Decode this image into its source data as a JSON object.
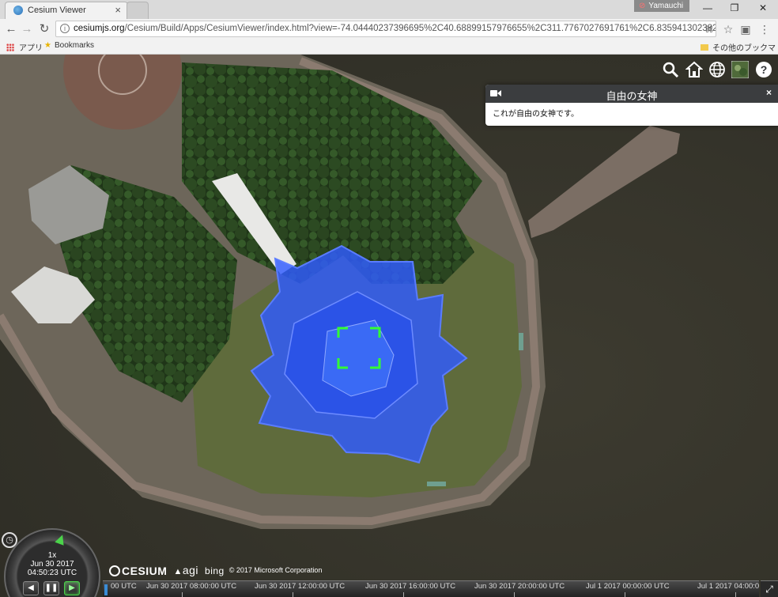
{
  "browser": {
    "tab_title": "Cesium Viewer",
    "tab_close": "×",
    "user_name": "Yamauchi",
    "window_min": "—",
    "window_restore": "❐",
    "window_close": "✕",
    "url_host": "cesiumjs.org",
    "url_rest": "/Cesium/Build/Apps/CesiumViewer/index.html?view=-74.04440237396695%2C40.68899157976655%2C311.7767027691761%2C6.835941302382751%2C-8",
    "bookmarks": {
      "apps": "アプリ",
      "bookmarks": "Bookmarks",
      "other": "その他のブックマーク"
    }
  },
  "toolbar_icons": [
    "search-icon",
    "home-icon",
    "globe-icon",
    "imagery-layer-icon",
    "help-icon"
  ],
  "infobox": {
    "title": "自由の女神",
    "description": "これが自由の女神です。",
    "close_label": "×"
  },
  "animation": {
    "speed": "1x",
    "date": "Jun 30 2017",
    "time": "04:50:23 UTC"
  },
  "credits": {
    "cesium": "CESIUM",
    "agi": "agi",
    "bing": "bing",
    "copyright": "© 2017 Microsoft Corporation"
  },
  "timeline": {
    "labels": [
      "00 UTC",
      "Jun 30 2017 08:00:00 UTC",
      "Jun 30 2017 12:00:00 UTC",
      "Jun 30 2017 16:00:00 UTC",
      "Jun 30 2017 20:00:00 UTC",
      "Jul 1 2017 00:00:00 UTC",
      "Jul 1 2017 04:00:0"
    ]
  },
  "colors": {
    "highlight_polygon": "#2f5cff",
    "selection_indicator": "#33ff33",
    "infobox_header": "#3b3d3f",
    "water": "#3a382e",
    "lawn": "#5f6b3c"
  }
}
